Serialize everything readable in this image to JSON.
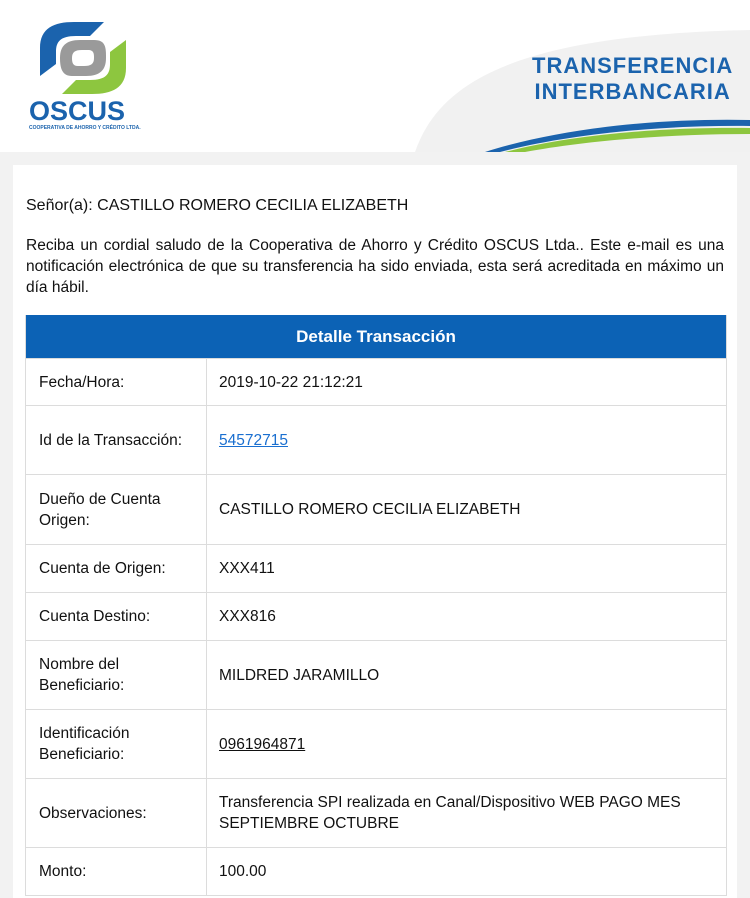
{
  "header": {
    "logo_text": "OSCUS",
    "logo_sub": "COOPERATIVA DE AHORRO Y CRÉDITO LTDA.",
    "banner_line1": "TRANSFERENCIA",
    "banner_line2": "INTERBANCARIA"
  },
  "email": {
    "greeting": "Señor(a): CASTILLO ROMERO CECILIA ELIZABETH",
    "intro": "Reciba un cordial saludo de la Cooperativa de Ahorro y Crédito OSCUS Ltda.. Este e-mail es una notificación electrónica de que su transferencia ha sido enviada, esta será acreditada en máximo un día hábil."
  },
  "table": {
    "title": "Detalle Transacción",
    "rows": [
      {
        "label": "Fecha/Hora:",
        "value": "2019-10-22 21:12:21"
      },
      {
        "label": "Id de la Transacción:",
        "value": "54572715"
      },
      {
        "label": "Dueño de Cuenta Origen:",
        "value": "CASTILLO ROMERO CECILIA ELIZABETH"
      },
      {
        "label": "Cuenta de Origen:",
        "value": "XXX411"
      },
      {
        "label": "Cuenta Destino:",
        "value": "XXX816"
      },
      {
        "label": "Nombre del Beneficiario:",
        "value": "MILDRED JARAMILLO"
      },
      {
        "label": "Identificación Beneficiario:",
        "value": "0961964871"
      },
      {
        "label": "Observaciones:",
        "value": "Transferencia SPI realizada en Canal/Dispositivo WEB PAGO MES SEPTIEMBRE OCTUBRE"
      },
      {
        "label": "Monto:",
        "value": "100.00"
      }
    ]
  },
  "colors": {
    "brand_blue": "#1b63ad",
    "table_header": "#0c62b5",
    "logo_green": "#8dc63f",
    "logo_grey": "#9a9a9a"
  }
}
